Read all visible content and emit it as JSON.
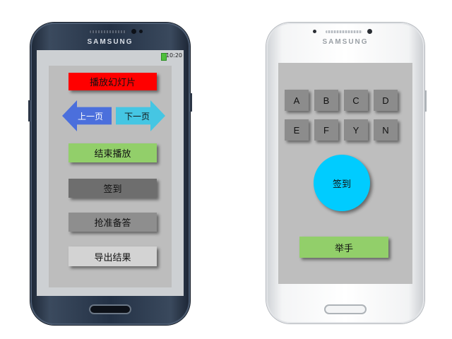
{
  "teacher_phone": {
    "brand": "SAMSUNG",
    "status": {
      "time": "10:20"
    },
    "buttons": {
      "play_slides": "播放幻灯片",
      "prev_page": "上一页",
      "next_page": "下一页",
      "end_play": "结束播放",
      "check_in": "签到",
      "quick_answer": "抢准备答",
      "export_results": "导出结果"
    }
  },
  "student_phone": {
    "brand": "SAMSUNG",
    "answer_keys": [
      "A",
      "B",
      "C",
      "D",
      "E",
      "F",
      "Y",
      "N"
    ],
    "check_in": "签到",
    "raise_hand": "举手"
  },
  "colors": {
    "play_button": "#ff0000",
    "prev_arrow": "#4b6fdc",
    "next_arrow": "#45c6e3",
    "green_button": "#92cf6a",
    "check_in_circle": "#00ccff"
  }
}
